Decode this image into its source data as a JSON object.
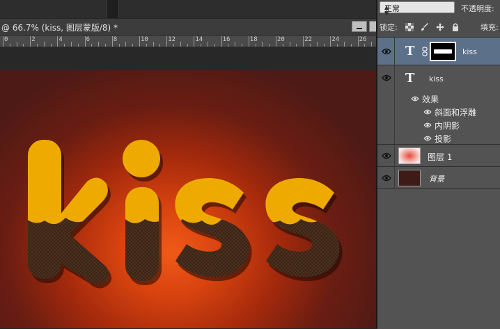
{
  "document": {
    "tab_title": "@ 66.7% (kiss, 图层蒙版/8) *"
  },
  "ruler": {
    "labels": [
      "0",
      "2",
      "4",
      "6",
      "8",
      "10",
      "12",
      "14",
      "16",
      "18",
      "20",
      "22",
      "24",
      "26"
    ]
  },
  "canvas": {
    "text": "kiss",
    "colors": {
      "top_fill": "#efaa00",
      "bottom_fill": "#3a2414",
      "bg_center": "#f05a18",
      "bg_edge": "#4d1a16"
    }
  },
  "panel": {
    "blend_mode": "正常",
    "opacity_label": "不透明度:",
    "lock_label": "锁定:",
    "fill_label": "填充:",
    "lock_icons": [
      "checker-icon",
      "brush-icon",
      "move-icon",
      "lock-icon"
    ]
  },
  "layers": [
    {
      "name": "kiss",
      "type": "text-masked",
      "selected": true
    },
    {
      "name": "kiss",
      "type": "text",
      "selected": false,
      "effects_label": "效果",
      "effects": [
        "斜面和浮雕",
        "内阴影",
        "投影"
      ]
    },
    {
      "name": "图层 1",
      "type": "pixel",
      "selected": false
    },
    {
      "name": "背景",
      "type": "background",
      "selected": false
    }
  ]
}
